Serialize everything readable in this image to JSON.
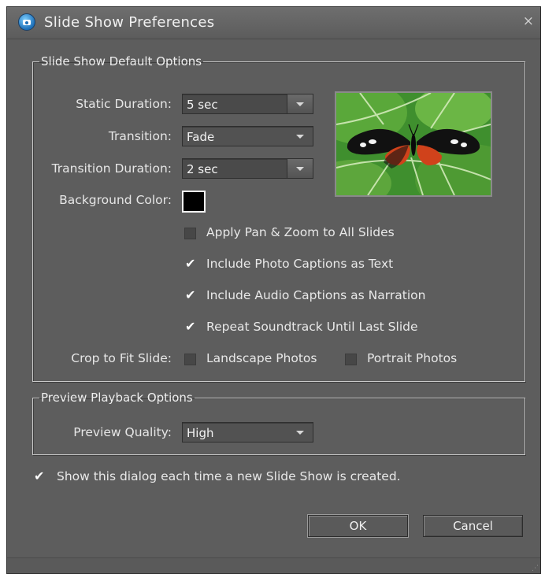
{
  "window": {
    "title": "Slide Show Preferences",
    "close_glyph": "×"
  },
  "default_options": {
    "legend": "Slide Show Default Options",
    "static_duration": {
      "label": "Static Duration:",
      "value": "5 sec"
    },
    "transition": {
      "label": "Transition:",
      "value": "Fade"
    },
    "transition_duration": {
      "label": "Transition Duration:",
      "value": "2 sec"
    },
    "background_color": {
      "label": "Background Color:",
      "color": "#000000"
    },
    "checkboxes": [
      {
        "label": "Apply Pan & Zoom to All Slides",
        "checked": false
      },
      {
        "label": "Include Photo Captions as Text",
        "checked": true
      },
      {
        "label": "Include Audio Captions as Narration",
        "checked": true
      },
      {
        "label": "Repeat Soundtrack Until Last Slide",
        "checked": true
      }
    ],
    "crop": {
      "label": "Crop to Fit Slide:",
      "landscape": {
        "label": "Landscape Photos",
        "checked": false
      },
      "portrait": {
        "label": "Portrait Photos",
        "checked": false
      }
    },
    "preview_image": "butterfly-on-leaf"
  },
  "preview_options": {
    "legend": "Preview Playback Options",
    "quality": {
      "label": "Preview Quality:",
      "value": "High"
    }
  },
  "show_dialog": {
    "label": "Show this dialog each time a new Slide Show is created.",
    "checked": true
  },
  "buttons": {
    "ok": "OK",
    "cancel": "Cancel"
  },
  "colors": {
    "dialog_bg": "#5d5d5d",
    "field_bg": "#4a4a4a",
    "text": "#e8e8e8"
  }
}
